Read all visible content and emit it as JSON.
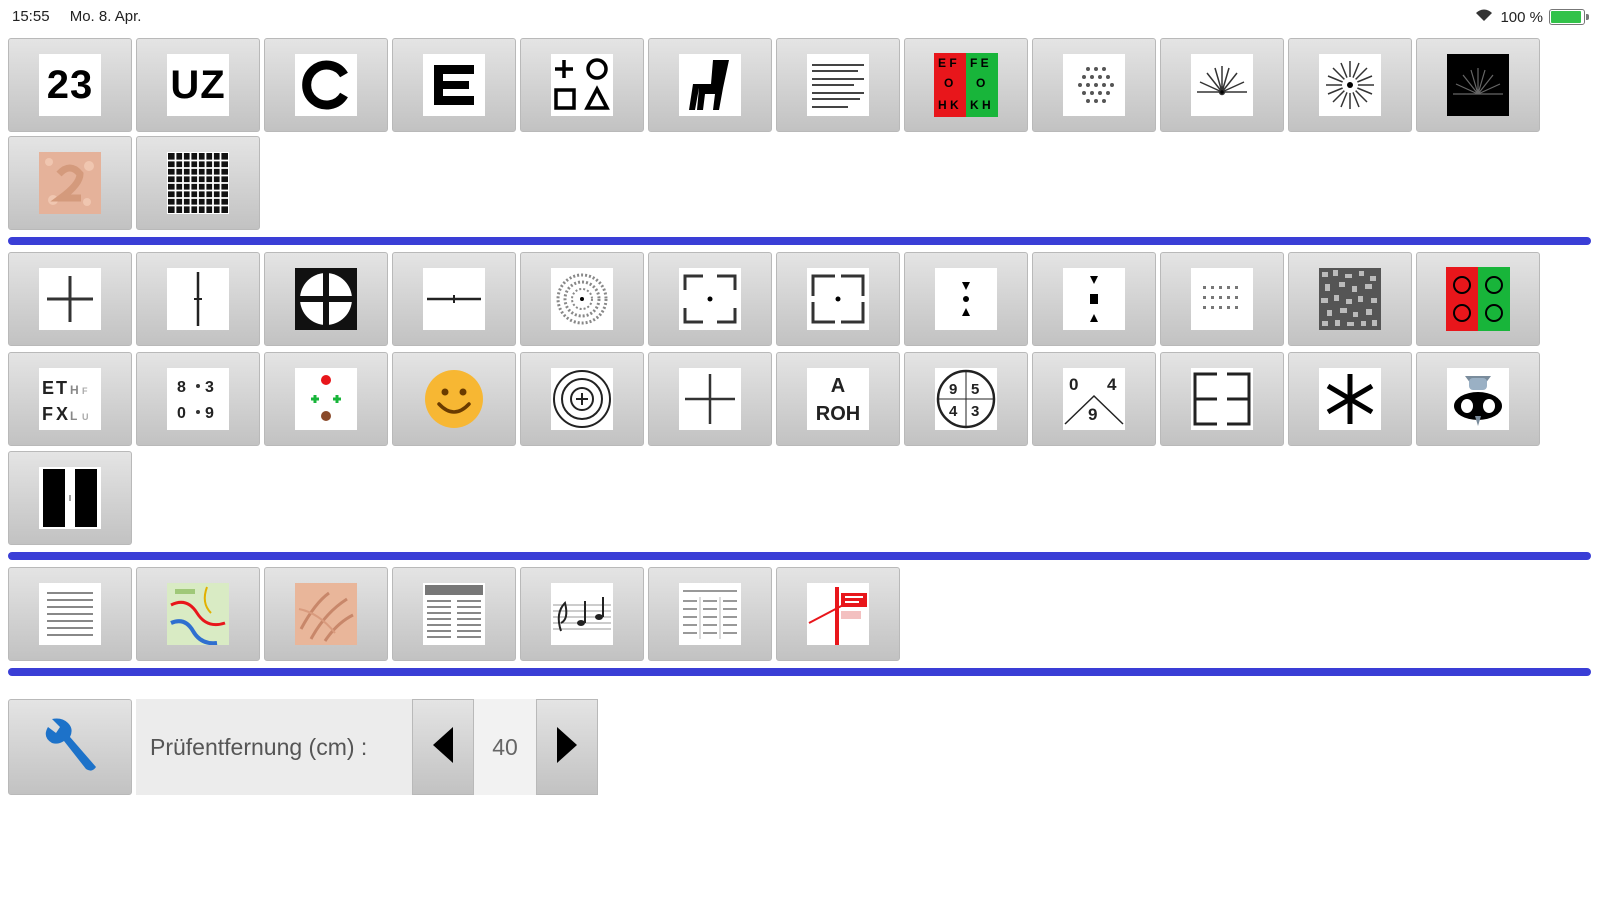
{
  "status": {
    "time": "15:55",
    "date": "Mo. 8. Apr.",
    "battery": "100 %",
    "battery_level": 1.0
  },
  "tiles": {
    "numbers_label": "23",
    "letters_label": "UZ",
    "pictogram_letters": "E T H F X L U",
    "numbers_grid": "8 3 0 9",
    "letters_aroh_top": "A",
    "letters_aroh_bottom": "ROH",
    "numbers_circle": "9 5 4 3",
    "numbers_triangle": "0 4 9",
    "redgreen_letters": "E F F E O O H K K H"
  },
  "distance": {
    "label": "Prüfentfernung (cm) :",
    "value": "40"
  },
  "colors": {
    "accent_blue": "#3a3ed6",
    "red": "#e8161b",
    "green": "#18b53a",
    "wrench": "#1d72c9"
  }
}
